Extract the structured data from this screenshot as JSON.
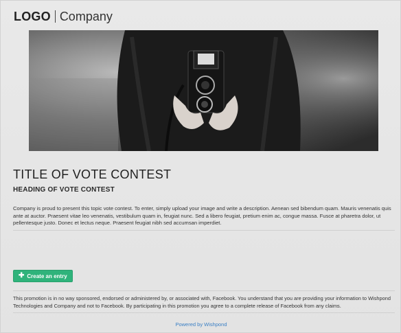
{
  "header": {
    "logo": "LOGO",
    "company": "Company"
  },
  "hero": {
    "image_icon": "camera-photo"
  },
  "contest": {
    "title": "TITLE OF VOTE CONTEST",
    "heading": "HEADING OF VOTE CONTEST",
    "description": "Company is proud to present this topic vote contest. To enter, simply upload your image and write a description. Aenean sed bibendum quam. Mauris venenatis quis ante at auctor. Praesent vitae leo venenatis, vestibulum quam in, feugiat nunc. Sed a libero feugiat, pretium enim ac, congue massa. Fusce at pharetra dolor, ut pellentesque justo. Donec et lectus neque. Praesent feugiat nibh sed accumsan imperdiet."
  },
  "actions": {
    "create_entry_label": "Create an entry",
    "create_entry_icon": "plus-icon"
  },
  "footer": {
    "disclaimer": "This promotion is in no way sponsored, endorsed or administered by, or associated with, Facebook. You understand that you are providing your information to Wishpond Technologies and Company and not to Facebook. By participating in this promotion you agree to a complete release of Facebook from any claims.",
    "powered_by": "Powered by Wishpond"
  },
  "colors": {
    "accent": "#2fb37b",
    "link": "#3a7fc4",
    "background": "#e6e6e6"
  }
}
